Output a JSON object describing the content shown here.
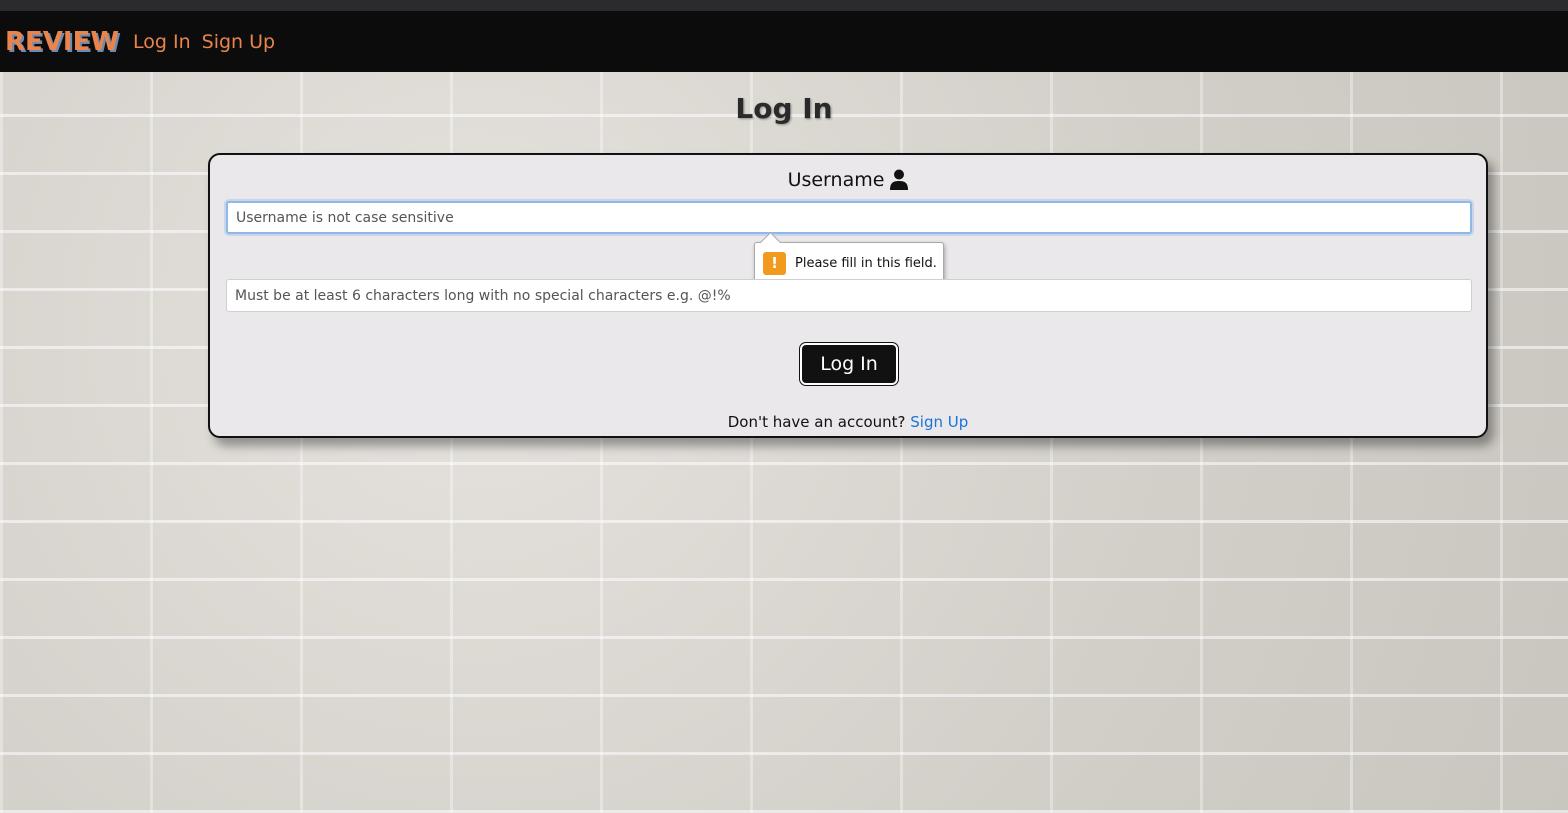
{
  "navbar": {
    "brand": "REVIEW",
    "links": [
      {
        "label": "Log In"
      },
      {
        "label": "Sign Up"
      }
    ]
  },
  "page": {
    "title": "Log In"
  },
  "form": {
    "username_label": "Username",
    "username_placeholder": "Username is not case sensitive",
    "password_placeholder": "Must be at least 6 characters long with no special characters e.g. @!%",
    "validation_message": "Please fill in this field.",
    "submit_label": "Log In",
    "signup_prompt": "Don't have an account?",
    "signup_link": "Sign Up"
  },
  "icons": {
    "username": "user-icon",
    "validation": "warning-icon"
  },
  "colors": {
    "brand": "#e8844c",
    "navbar_bg": "#0d0c0c",
    "link": "#1a73d6",
    "warning": "#f29a1e"
  }
}
